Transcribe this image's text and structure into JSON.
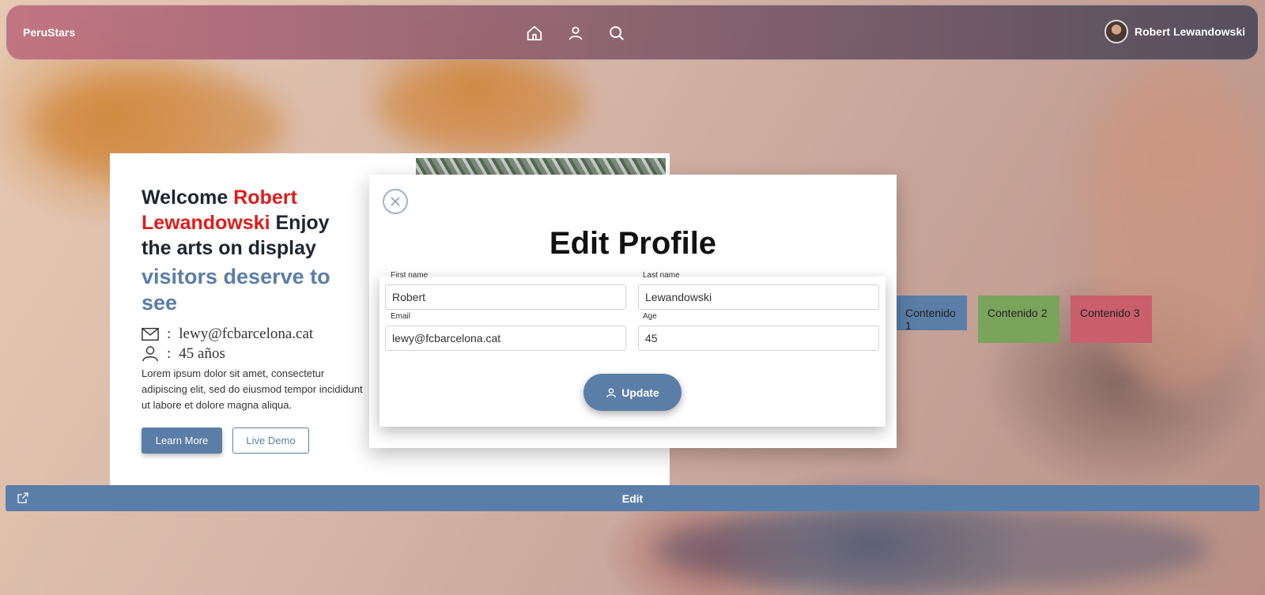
{
  "navbar": {
    "brand": "PeruStars",
    "icons": [
      "home-icon",
      "user-icon",
      "search-icon"
    ],
    "user_name": "Robert Lewandowski"
  },
  "card": {
    "welcome_prefix": "Welcome ",
    "welcome_name": "Robert Lewandowski",
    "welcome_suffix": " Enjoy the arts on display",
    "tagline": "visitors deserve to see",
    "email_line": "lewy@fcbarcelona.cat",
    "age_line": "45  años",
    "separator": ":",
    "description": "Lorem ipsum dolor sit amet, consectetur adipiscing elit, sed do eiusmod tempor incididunt ut labore et dolore magna aliqua.",
    "learn_more": "Learn More",
    "live_demo": "Live Demo"
  },
  "chips": [
    {
      "label": "Contenido 1",
      "color": "#5b7ea8"
    },
    {
      "label": "Contenido 2",
      "color": "#7aa35c"
    },
    {
      "label": "Contenido 3",
      "color": "#c85f6a"
    }
  ],
  "modal": {
    "title": "Edit Profile",
    "fields": {
      "first_name": {
        "label": "First name",
        "value": "Robert"
      },
      "last_name": {
        "label": "Last name",
        "value": "Lewandowski"
      },
      "email": {
        "label": "Email",
        "value": "lewy@fcbarcelona.cat"
      },
      "age": {
        "label": "Age",
        "value": "45"
      }
    },
    "update_label": "Update"
  },
  "edit_bar": {
    "label": "Edit"
  },
  "colors": {
    "accent": "#5b7ea8",
    "highlight_red": "#e01c1c"
  }
}
